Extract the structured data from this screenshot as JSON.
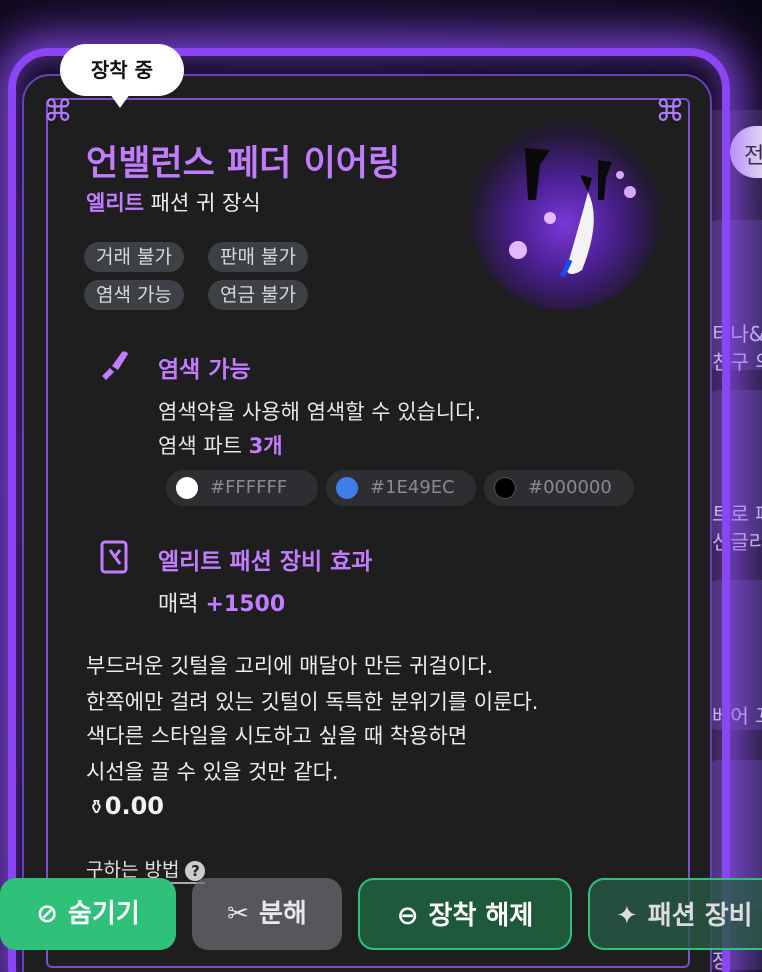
{
  "status_bubble": "장착 중",
  "item": {
    "name": "언밸런스 페더 이어링",
    "grade": "엘리트",
    "category": "패션 귀 장식",
    "tags": [
      "거래 불가",
      "판매 불가",
      "염색 가능",
      "연금 불가"
    ]
  },
  "dye": {
    "title": "염색 가능",
    "description": "염색약을 사용해 염색할 수 있습니다.",
    "parts_label": "염색 파트",
    "parts_count": "3개",
    "colors": [
      {
        "hex": "#FFFFFF",
        "label": "#FFFFFF"
      },
      {
        "hex": "#1E49EC",
        "label": "#1E49EC"
      },
      {
        "hex": "#000000",
        "label": "#000000"
      }
    ]
  },
  "effect": {
    "title": "엘리트 패션 장비 효과",
    "stat_label": "매력",
    "stat_value": "+1500"
  },
  "description_lines": [
    "부드러운 깃털을 고리에 매달아 만든 귀걸이다.",
    "한쪽에만 걸려 있는 깃털이 독특한 분위기를 이룬다.",
    "색다른 스타일을 시도하고 싶을 때 착용하면",
    "시선을 끌 수 있을 것만 같다."
  ],
  "price": "0.00",
  "how_to_obtain": "구하는 방법",
  "buttons": {
    "hide": "숨기기",
    "disassemble": "분해",
    "unequip": "장착 해제",
    "fashion": "패션 장비"
  },
  "background_panel": {
    "tab": "전",
    "texts": [
      "티나&폰",
      "친구 의",
      "트로 패",
      "선글라",
      "베어 꼬",
      "장"
    ]
  },
  "colors": {
    "accent_purple": "#C27DFF",
    "green_button": "#2FC07A",
    "card_bg": "#1E1E1F"
  }
}
